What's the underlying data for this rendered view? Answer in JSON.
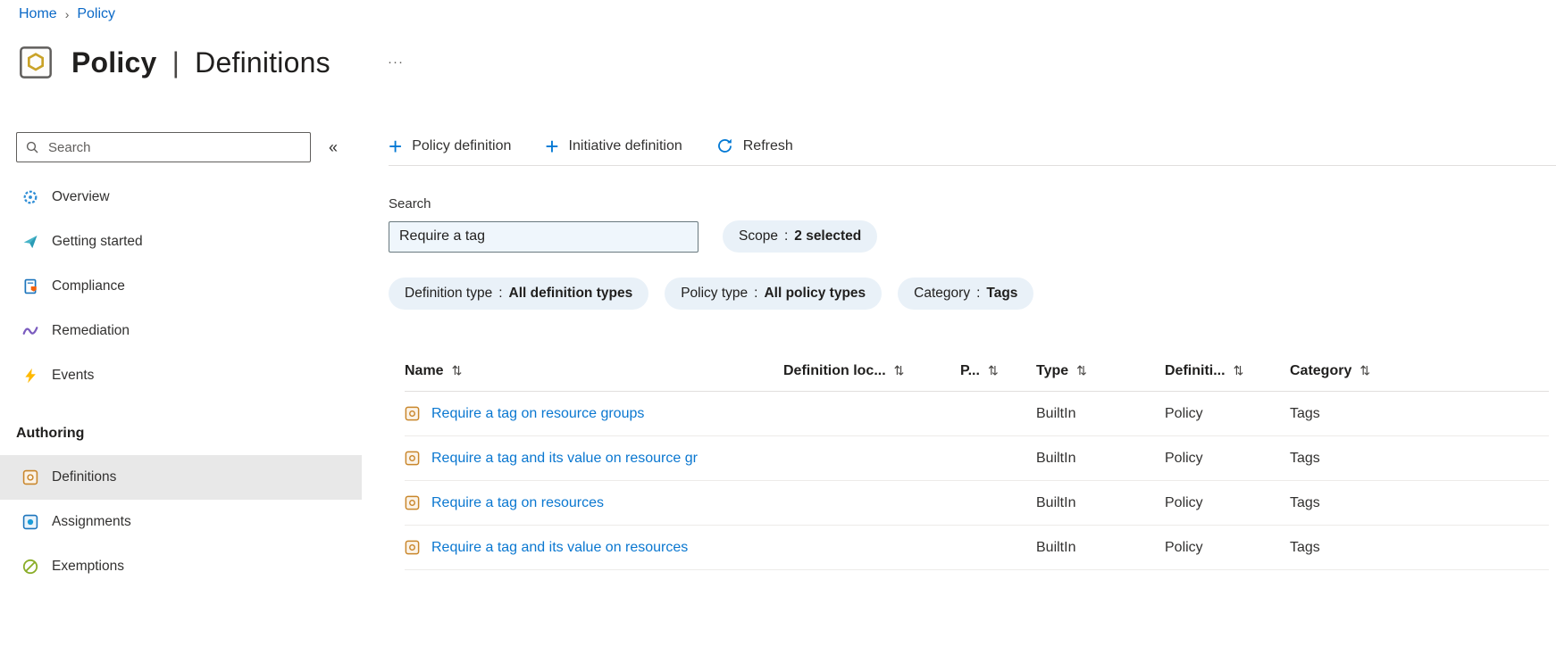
{
  "breadcrumb": {
    "items": [
      {
        "label": "Home"
      },
      {
        "label": "Policy"
      }
    ],
    "separator": "›"
  },
  "header": {
    "title_primary": "Policy",
    "title_divider": "|",
    "title_secondary": "Definitions",
    "more_label": "···"
  },
  "sidebar": {
    "search": {
      "placeholder": "Search"
    },
    "collapse_glyph": "«",
    "items": [
      {
        "label": "Overview"
      },
      {
        "label": "Getting started"
      },
      {
        "label": "Compliance"
      },
      {
        "label": "Remediation"
      },
      {
        "label": "Events"
      }
    ],
    "section_label": "Authoring",
    "authoring_items": [
      {
        "label": "Definitions"
      },
      {
        "label": "Assignments"
      },
      {
        "label": "Exemptions"
      }
    ],
    "selected_item": "Definitions"
  },
  "toolbar": {
    "plus_glyph": "+",
    "policy_definition": "Policy definition",
    "initiative_definition": "Initiative definition",
    "refresh": "Refresh"
  },
  "filters": {
    "search_label": "Search",
    "search_value": "Require a tag",
    "pills": [
      {
        "name": "Scope",
        "separator": ":",
        "value": "2 selected"
      },
      {
        "name": "Definition type",
        "separator": ":",
        "value": "All definition types"
      },
      {
        "name": "Policy type",
        "separator": ":",
        "value": "All policy types"
      },
      {
        "name": "Category",
        "separator": ":",
        "value": "Tags"
      }
    ]
  },
  "table": {
    "columns": [
      {
        "label": "Name",
        "sort_glyph": "⇅"
      },
      {
        "label": "Definition loc...",
        "sort_glyph": "⇅"
      },
      {
        "label": "P...",
        "sort_glyph": "⇅"
      },
      {
        "label": "Type",
        "sort_glyph": "⇅"
      },
      {
        "label": "Definiti...",
        "sort_glyph": "⇅"
      },
      {
        "label": "Category",
        "sort_glyph": "⇅"
      }
    ],
    "rows": [
      {
        "name": "Require a tag on resource groups",
        "definition_location": "",
        "p": "",
        "type": "BuiltIn",
        "definition": "Policy",
        "category": "Tags"
      },
      {
        "name": "Require a tag and its value on resource gr",
        "definition_location": "",
        "p": "",
        "type": "BuiltIn",
        "definition": "Policy",
        "category": "Tags"
      },
      {
        "name": "Require a tag on resources",
        "definition_location": "",
        "p": "",
        "type": "BuiltIn",
        "definition": "Policy",
        "category": "Tags"
      },
      {
        "name": "Require a tag and its value on resources",
        "definition_location": "",
        "p": "",
        "type": "BuiltIn",
        "definition": "Policy",
        "category": "Tags"
      }
    ]
  },
  "colors": {
    "accent": "#0078d4",
    "link": "#0a77d0",
    "breadcrumb_link": "#0b69c7",
    "pill_bg": "#e9f1f8",
    "search_input_bg": "#eff6fc",
    "selected_nav_bg": "#e8e8e8"
  }
}
